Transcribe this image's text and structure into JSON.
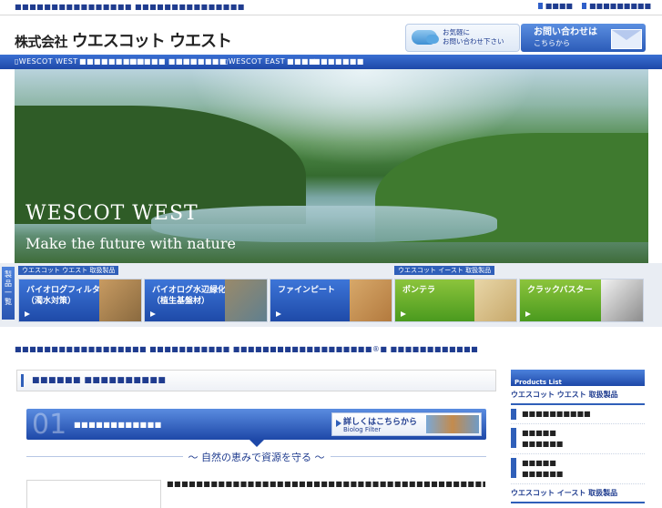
{
  "topbar": {
    "tagline": "■■■■■■■■■■■■■■■■ ■■■■■■■■■■■■■■■",
    "links": [
      "■■■■",
      "■■■■■■■■■"
    ]
  },
  "header": {
    "logo_small": "株式会社",
    "logo_big": "ウエスコット ウエスト",
    "bubble_line1": "お気軽に",
    "bubble_line2": "お問い合わせ下さい",
    "contact_line1": "お問い合わせは",
    "contact_line2": "こちらから"
  },
  "nav": {
    "items": [
      "▯WESCOT WEST",
      "■■■■■■■■■",
      "■■■■■ ■■■■",
      "■■■■■■■",
      "▯WESCOT EAST",
      "■■■■",
      "■■■■■■■"
    ]
  },
  "hero": {
    "brand": "WESCOT WEST",
    "slogan": "Make the future with nature"
  },
  "products": {
    "side_tab": "製品一覧",
    "group_west": "ウエスコット ウエスト 取扱製品",
    "group_east": "ウエスコット イースト 取扱製品",
    "items": [
      {
        "line1": "バイオログフィルター",
        "line2": "（濁水対策）"
      },
      {
        "line1": "バイオログ水辺緑化",
        "line2": "（植生基盤材）"
      },
      {
        "line1": "ファインピート",
        "line2": ""
      },
      {
        "line1": "ポンテラ",
        "line2": ""
      },
      {
        "line1": "クラックバスター",
        "line2": ""
      }
    ]
  },
  "intro": "■■■■■■■■■■■■■■■■■■ ■■■■■■■■■■■ ■■■■■■■■■■■■■■■■■■■®■ ■■■■■■■■■■■■■■■■■■■■■■■ ■■■■■■■■■■■■■■ ■■■■■■",
  "section": {
    "title": "■■■■■■ ■■■■■■■■■■"
  },
  "panel": {
    "number": "01",
    "title": "■■■■■■■■■■■■",
    "more_line1": "詳しくはこちらから",
    "more_line2": "Biolog Filter",
    "subtitle": "～ 自然の恵みで資源を守る ～",
    "body": "■■■■■■■■■■■■■■■■■■■■■■■■■■■■■■■■■■■■■■■■■■■■■■■■■■■■■■■■■"
  },
  "sidebar": {
    "head": "Products List",
    "group_west": "ウエスコット ウエスト 取扱製品",
    "west_items": [
      "■■■■■■■■■■",
      "■■■■■\n■■■■■■",
      "■■■■■\n■■■■■■"
    ],
    "group_east": "ウエスコット イースト 取扱製品"
  }
}
